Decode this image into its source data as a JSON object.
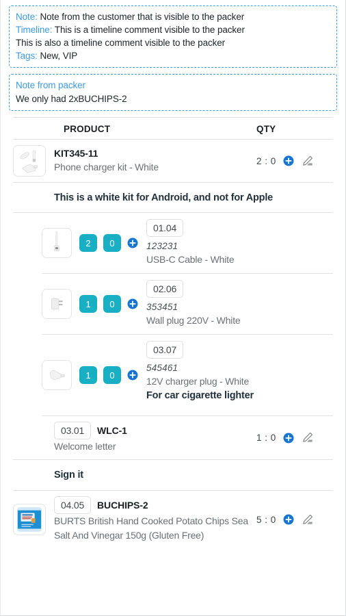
{
  "notes": {
    "customer_box": {
      "note_label": "Note:",
      "note_text": "Note from the customer that is visible to the packer",
      "timeline_label": "Timeline:",
      "timeline_text": "This is a timeline comment visible to the packer",
      "timeline_text_2": "This is also a timeline comment visible to the packer",
      "tags_label": "Tags:",
      "tags_text": "New, VIP"
    },
    "packer_box": {
      "title": "Note from packer",
      "text": "We only had 2xBUCHIPS-2"
    }
  },
  "table": {
    "headers": {
      "product": "PRODUCT",
      "qty": "QTY"
    },
    "rows": [
      {
        "sku": "KIT345-11",
        "name": "Phone charger kit - White",
        "qty": "2 : 0",
        "image": "phone-charger-kit-thumbnail",
        "note": "This is a white kit for Android, and not for Apple",
        "components": [
          {
            "picked": "2",
            "remaining": "0",
            "position": "01.04",
            "ean": "123231",
            "name": "USB-C Cable - White",
            "image": "usb-c-cable-thumbnail",
            "note": ""
          },
          {
            "picked": "1",
            "remaining": "0",
            "position": "02.06",
            "ean": "353451",
            "name": "Wall plug 220V - White",
            "image": "wall-plug-thumbnail",
            "note": ""
          },
          {
            "picked": "1",
            "remaining": "0",
            "position": "03.07",
            "ean": "545461",
            "name": "12V charger plug - White",
            "image": "car-charger-thumbnail",
            "note": "For car cigarette lighter"
          }
        ]
      },
      {
        "position": "03.01",
        "sku": "WLC-1",
        "name": "Welcome letter",
        "qty": "1 : 0",
        "note": "Sign it"
      },
      {
        "position": "04.05",
        "sku": "BUCHIPS-2",
        "name": "BURTS British Hand Cooked Potato Chips Sea Salt And Vinegar 150g (Gluten Free)",
        "qty": "5 : 0",
        "image": "burts-chips-thumbnail"
      }
    ]
  },
  "icons": {
    "add": "plus-circle-icon",
    "edit": "pencil-icon"
  },
  "colors": {
    "accent_blue": "#1675d1",
    "link_blue": "#3d9ae2",
    "badge_teal": "#18aec4",
    "border_gray": "#dfe2e5"
  }
}
